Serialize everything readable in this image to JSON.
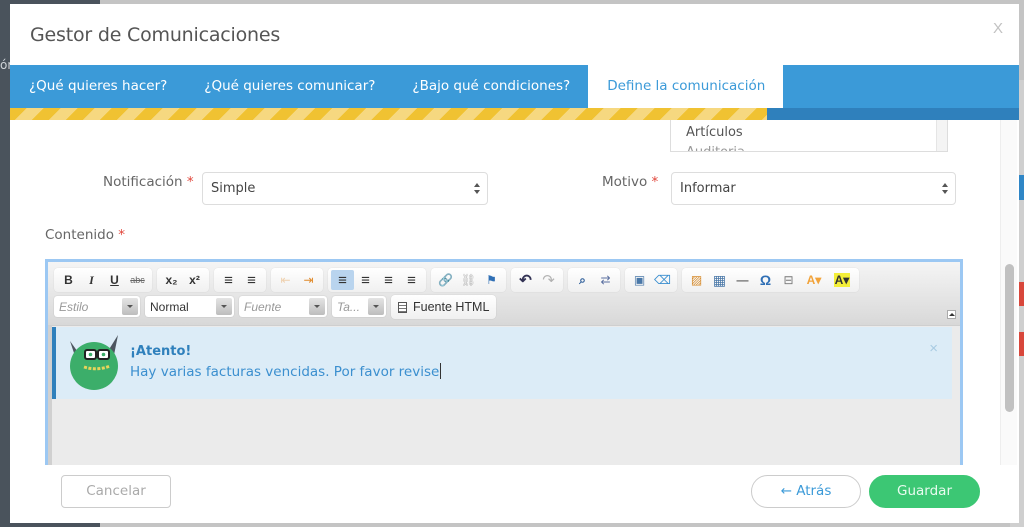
{
  "background": {
    "sidebar_partial_text": "ón"
  },
  "modal": {
    "title": "Gestor de Comunicaciones",
    "close_label": "X",
    "tabs": [
      {
        "label": "¿Qué quieres hacer?",
        "active": false
      },
      {
        "label": "¿Qué quieres comunicar?",
        "active": false
      },
      {
        "label": "¿Bajo qué condiciones?",
        "active": false
      },
      {
        "label": "Define la comunicación",
        "active": true
      }
    ],
    "progress_percent": 75,
    "listbox": {
      "items": [
        "Artículos",
        "Auditoria"
      ]
    },
    "fields": {
      "notificacion": {
        "label": "Notificación",
        "required_mark": "*",
        "value": "Simple"
      },
      "motivo": {
        "label": "Motivo",
        "required_mark": "*",
        "value": "Informar"
      },
      "contenido": {
        "label": "Contenido",
        "required_mark": "*"
      }
    },
    "editor": {
      "toolbar_row1": [
        {
          "name": "bold-button",
          "glyph": "B"
        },
        {
          "name": "italic-button",
          "glyph": "I"
        },
        {
          "name": "underline-button",
          "glyph": "U"
        },
        {
          "name": "strikethrough-button",
          "glyph": "abc"
        },
        {
          "name": "subscript-button",
          "glyph": "x₂"
        },
        {
          "name": "superscript-button",
          "glyph": "x²"
        },
        {
          "name": "numbered-list-button",
          "glyph": "≡"
        },
        {
          "name": "bullet-list-button",
          "glyph": "≡"
        },
        {
          "name": "outdent-button",
          "glyph": "⇤"
        },
        {
          "name": "indent-button",
          "glyph": "⇥"
        },
        {
          "name": "align-left-button",
          "glyph": "≡"
        },
        {
          "name": "align-center-button",
          "glyph": "≡"
        },
        {
          "name": "align-right-button",
          "glyph": "≡"
        },
        {
          "name": "justify-button",
          "glyph": "≡"
        },
        {
          "name": "link-button",
          "glyph": "🔗"
        },
        {
          "name": "unlink-button",
          "glyph": "⛓"
        },
        {
          "name": "anchor-button",
          "glyph": "⚑"
        },
        {
          "name": "undo-button",
          "glyph": "↶"
        },
        {
          "name": "redo-button",
          "glyph": "↷"
        },
        {
          "name": "find-button",
          "glyph": "⌕"
        },
        {
          "name": "replace-button",
          "glyph": "⇄"
        },
        {
          "name": "select-all-button",
          "glyph": "▣"
        },
        {
          "name": "remove-format-button",
          "glyph": "⌫"
        },
        {
          "name": "image-button",
          "glyph": "▨"
        },
        {
          "name": "table-button",
          "glyph": "▦"
        },
        {
          "name": "horizontal-rule-button",
          "glyph": "—"
        },
        {
          "name": "special-char-button",
          "glyph": "Ω"
        },
        {
          "name": "page-break-button",
          "glyph": "⊟"
        },
        {
          "name": "text-color-button",
          "glyph": "A▾"
        },
        {
          "name": "bg-color-button",
          "glyph": "A▾"
        }
      ],
      "style_placeholder": "Estilo",
      "format_value": "Normal",
      "font_placeholder": "Fuente",
      "size_placeholder": "Ta...",
      "source_label": "Fuente HTML",
      "alert": {
        "title": "¡Atento!",
        "text": "Hay varias facturas vencidas. Por favor revise",
        "close_glyph": "×"
      }
    },
    "footer": {
      "cancel_label": "Cancelar",
      "back_label": "← Atrás",
      "save_label": "Guardar"
    }
  },
  "colors": {
    "tab_bar": "#3b9ad8",
    "progress_stripe": "#f0c232",
    "save_green": "#3cc774",
    "required_red": "#e0453a"
  }
}
